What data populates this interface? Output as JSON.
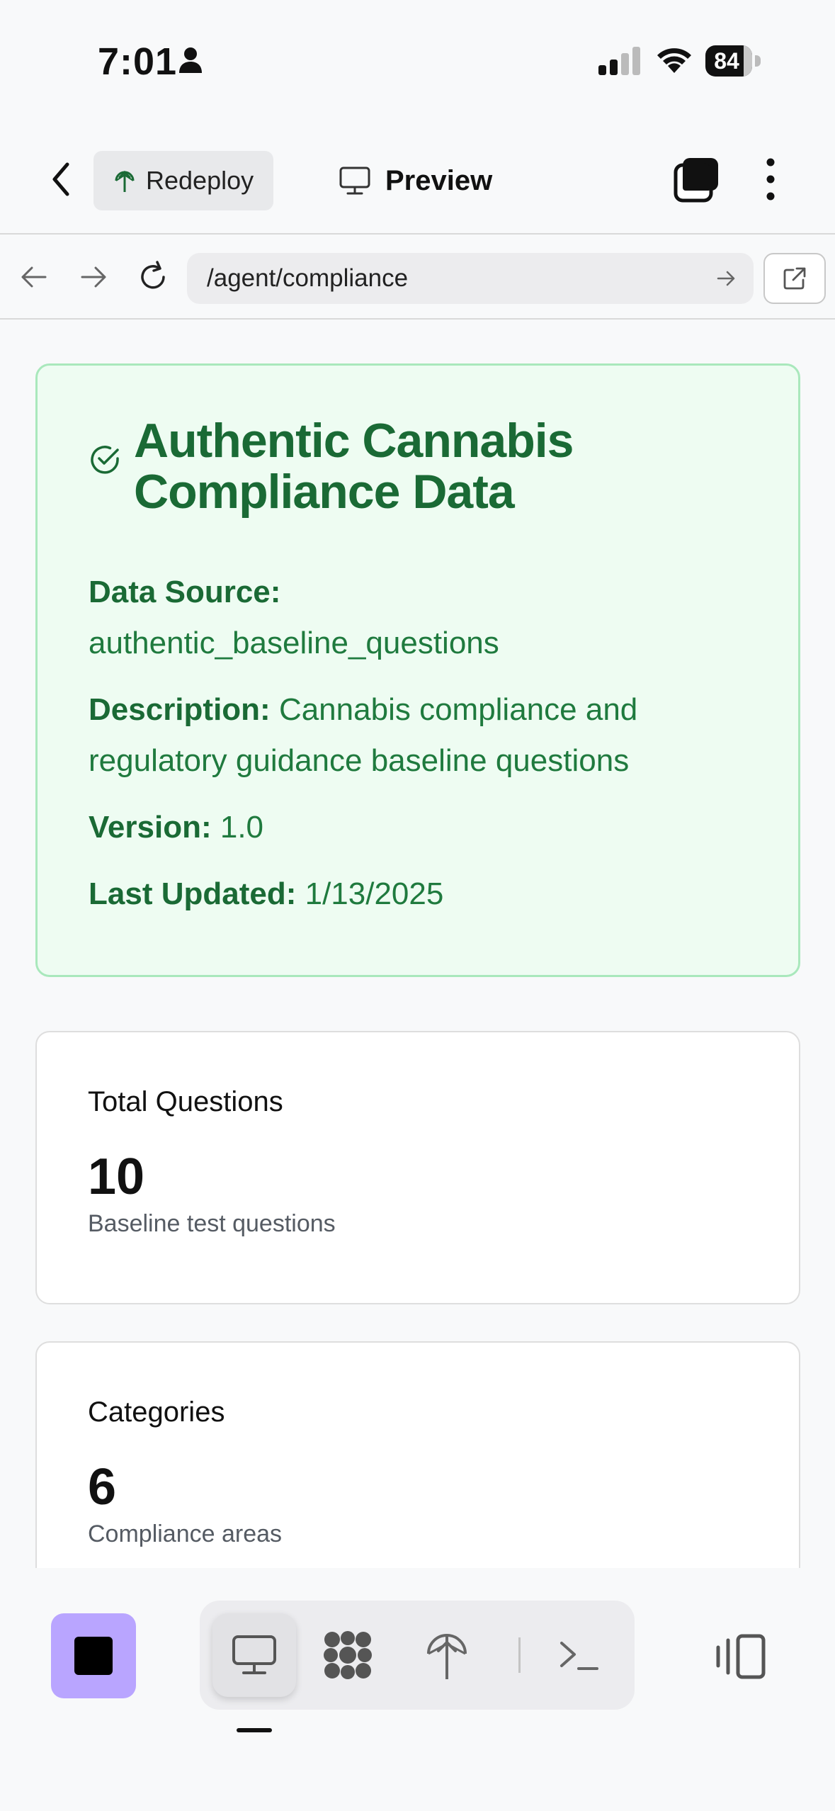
{
  "status_bar": {
    "time": "7:01",
    "battery": "84"
  },
  "header": {
    "redeploy_label": "Redeploy",
    "preview_label": "Preview"
  },
  "url_bar": {
    "url": "/agent/compliance"
  },
  "info_card": {
    "title": "Authentic Cannabis Compliance Data",
    "data_source_label": "Data Source:",
    "data_source_value": "authentic_baseline_questions",
    "description_label": "Description:",
    "description_value": "Cannabis compliance and regulatory guidance baseline questions",
    "version_label": "Version:",
    "version_value": "1.0",
    "last_updated_label": "Last Updated:",
    "last_updated_value": "1/13/2025"
  },
  "stats": [
    {
      "title": "Total Questions",
      "value": "10",
      "subtitle": "Baseline test questions"
    },
    {
      "title": "Categories",
      "value": "6",
      "subtitle": "Compliance areas"
    }
  ],
  "bottom_toolbar": {
    "stop_color": "#b9a5ff",
    "tools": [
      "preview-icon",
      "agent-icon",
      "deploy-icon",
      "shell-icon"
    ]
  },
  "colors": {
    "success_text": "#1a6a35",
    "success_bg": "#eefcf2",
    "success_border": "#a9e8bc"
  }
}
